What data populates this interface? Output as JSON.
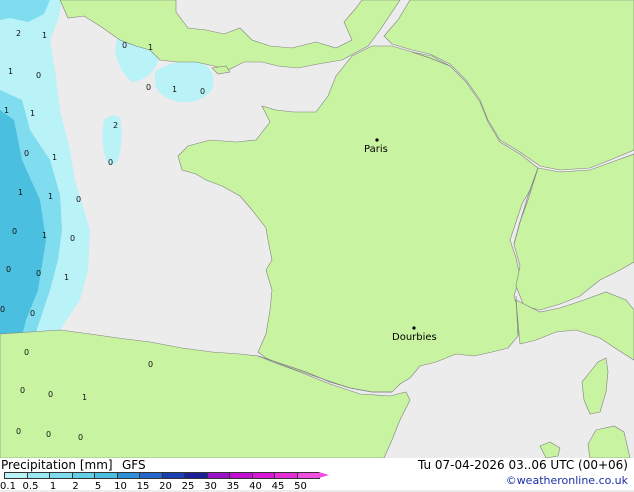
{
  "legend": {
    "title": "Precipitation [mm]",
    "model": "GFS",
    "valid_time": "Tu 07-04-2026 03..06 UTC (00+06)",
    "credit": "©weatheronline.co.uk",
    "scale_labels": [
      "0.1",
      "0.5",
      "1",
      "2",
      "5",
      "10",
      "15",
      "20",
      "25",
      "30",
      "35",
      "40",
      "45",
      "50"
    ],
    "scale_colors": [
      "#b9f2f7",
      "#9ae8f2",
      "#7fdcef",
      "#66cfe8",
      "#4bbfe0",
      "#2f8fd8",
      "#2566cc",
      "#1a3fb5",
      "#1a1f9a",
      "#9c12c9",
      "#c210d2",
      "#db17d6",
      "#e62fd9",
      "#f04fe0"
    ]
  },
  "map": {
    "colors": {
      "land": "#c8f3a0",
      "other_land": "#e7e7e7",
      "sea": "#ececec",
      "border": "#808080",
      "precip_light": "#b9f2f7",
      "precip_med": "#80dcef",
      "precip_heavy": "#4bbfe0"
    },
    "cities": [
      {
        "name": "Paris"
      },
      {
        "name": "Dourbies"
      }
    ],
    "precip_values": [
      "2",
      "1",
      "0",
      "1",
      "1",
      "0",
      "1",
      "0",
      "0",
      "1",
      "1",
      "2",
      "0",
      "1",
      "0",
      "1",
      "1",
      "0",
      "0",
      "1",
      "0",
      "0",
      "0",
      "1",
      "0",
      "0",
      "0",
      "0",
      "0",
      "0",
      "1",
      "0",
      "0",
      "0"
    ]
  }
}
